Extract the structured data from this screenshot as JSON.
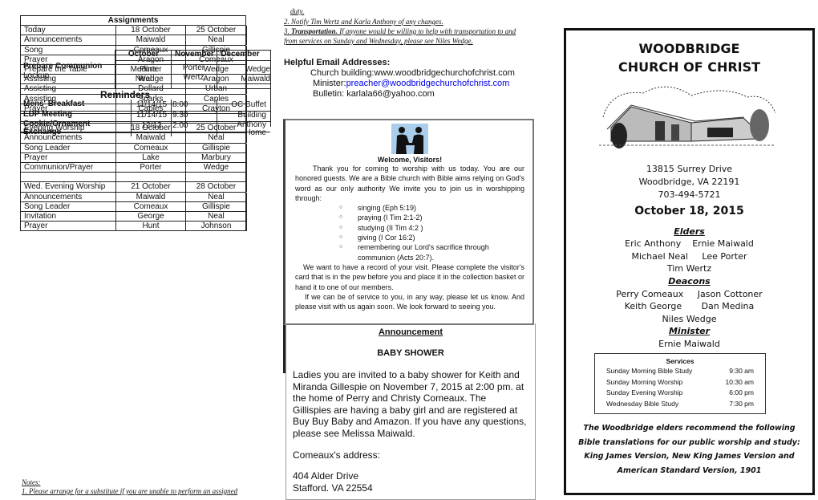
{
  "assignments": {
    "title": "Assignments",
    "rows": [
      [
        "Today",
        "18 October",
        "25 October"
      ],
      [
        "Announcements",
        "Maiwald",
        "Neal"
      ],
      [
        "Song",
        "Comeaux",
        "Gillispie"
      ],
      [
        "Prayer",
        "Aragon",
        "Comeaux"
      ],
      [
        "Prepare the Table",
        "Porter",
        "Wedge"
      ],
      [
        "Assisting",
        "Wedge",
        "Aragon"
      ],
      [
        "Assisting",
        "Dollard",
        "Urban"
      ],
      [
        "Assisting",
        "Sparks",
        "Caples"
      ],
      [
        "Prayer",
        "Caples",
        "Crayton"
      ],
      [
        "",
        "",
        ""
      ],
      [
        "Evening Worship",
        "18 October",
        "25 October"
      ],
      [
        "Announcements",
        "Maiwald",
        "Neal"
      ],
      [
        "Song Leader",
        "Comeaux",
        "Gillispie"
      ],
      [
        "Prayer",
        "Lake",
        "Marbury"
      ],
      [
        "Communion/Prayer",
        "Porter",
        "Wedge"
      ],
      [
        "",
        "",
        ""
      ],
      [
        "Wed. Evening Worship",
        "21 October",
        "28 October"
      ],
      [
        "Announcements",
        "Maiwald",
        "Neal"
      ],
      [
        "Song Leader",
        "Comeaux",
        "Gillispie"
      ],
      [
        "Invitation",
        "George",
        "Neal"
      ],
      [
        "Prayer",
        "Hunt",
        "Johnson"
      ]
    ]
  },
  "communion": {
    "headers": [
      "October",
      "November",
      "December"
    ],
    "rows": [
      [
        "Prepare Communion",
        "Medina",
        "Porter",
        "Wedge"
      ],
      [
        "Lockup",
        "Neal",
        "Wertz",
        "Maiwald"
      ]
    ]
  },
  "reminders": {
    "title": "Reminders",
    "rows": [
      [
        "Mens' Breakfast",
        "11/14/15",
        "8:00",
        "OC Buffet"
      ],
      [
        "EDP Meeting",
        "11/14/15",
        "9:30",
        "Building"
      ],
      [
        "Cookie/Ornament Exchange",
        "12/12",
        "2:00",
        "Anthony Home"
      ]
    ]
  },
  "notes": {
    "heading": "Notes:",
    "items": [
      "1. Please arrange for a substitute if you are unable to perform an assigned",
      "duty.",
      "2. Notify Tim Wertz and Karla Anthony of any changes."
    ],
    "item3_label": "Transportation.",
    "item3_prefix": "3. ",
    "item3_text": " If anyone would be willing to help with transportation to and",
    "item3_text2": "from services on Sunday and Wednesday, please see Niles Wedge."
  },
  "emails": {
    "heading": "Helpful Email Addresses:",
    "building": "Church building:www.woodbridgechurchofchrist.com",
    "minister_label": "Minister:",
    "minister_email": "preacher@woodbridgechurchofchrist.com",
    "bulletin": "Bulletin:  karlala66@yahoo.com"
  },
  "visitors": {
    "heading": "Welcome, Visitors!",
    "p1": "Thank you for coming to worship with us today.  You are our honored guests.  We are a Bible church with Bible aims relying on God's word as our only authority  We invite you to join us in worshipping through:",
    "list": [
      "singing (Eph 5:19)",
      "praying (I Tim 2:1-2)",
      "studying (II Tim 4:2 )",
      "giving (I Cor 16:2)",
      "remembering our Lord's sacrifice through communion (Acts 20:7)."
    ],
    "p2": "We want to have a record of your visit.  Please complete the visitor's card that is in the pew before you and place it in the collection basket or hand it to one of our members.",
    "p3": "If we can be of service to you, in any way, please let us know. And please visit with us again soon.  We look forward to seeing you."
  },
  "announcement": {
    "heading": "Announcement",
    "title": "BABY SHOWER",
    "body": "Ladies you are invited to a baby shower for Keith and Miranda Gillespie on November 7, 2015 at 2:00 pm. at the home of Perry and Christy Comeaux. The Gillispies are having a baby girl and are registered at Buy Buy Baby and Amazon. If you have any questions, please see Melissa Maiwald.",
    "address_label": "Comeaux's address:",
    "address1": "404 Alder Drive",
    "address2": "Stafford. VA 22554"
  },
  "church": {
    "name1": "WOODBRIDGE",
    "name2": "CHURCH OF CHRIST",
    "street": "13815 Surrey Drive",
    "city": "Woodbridge, VA 22191",
    "phone": "703-494-5721",
    "date": "October 18, 2015",
    "elders_heading": "Elders",
    "elders": [
      "Eric Anthony    Ernie Maiwald",
      "Michael Neal     Lee Porter",
      "Tim Wertz"
    ],
    "deacons_heading": "Deacons",
    "deacons": [
      "Perry Comeaux     Jason Cottoner",
      "Keith George       Dan Medina",
      "Niles Wedge"
    ],
    "minister_heading": "Minister",
    "minister": "Ernie Maiwald",
    "services_heading": "Services",
    "services": [
      [
        "Sunday Morning Bible Study",
        "9:30 am"
      ],
      [
        "Sunday Morning Worship",
        "10:30 am"
      ],
      [
        "Sunday Evening Worship",
        "6:00 pm"
      ],
      [
        "Wednesday Bible Study",
        "7:30 pm"
      ]
    ],
    "translations": [
      "The Woodbridge elders recommend the following",
      "Bible translations for our public worship and study:",
      "King James Version, New King James Version and",
      "American Standard Version, 1901"
    ]
  }
}
